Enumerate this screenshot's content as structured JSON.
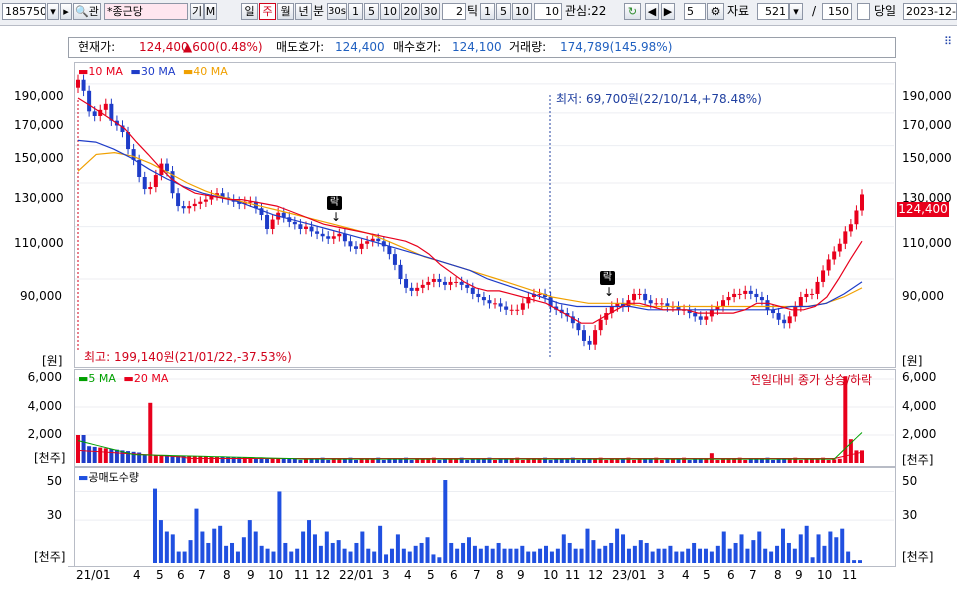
{
  "toolbar": {
    "code": "185750",
    "gwan": "관",
    "name": "*종근당",
    "gi": "기",
    "m": "M",
    "periods": [
      "일",
      "주",
      "월",
      "년"
    ],
    "selected_period": "주",
    "bun": "분",
    "s30": "30s",
    "n1": "1",
    "n5": "5",
    "n10": "10",
    "n20": "20",
    "n30": "30",
    "tick_value": "2",
    "tick": "틱",
    "t1": "1",
    "t5": "5",
    "t10": "10",
    "t10b": "10",
    "gwansim": "관심:22",
    "step_value": "5",
    "jaryo": "자료",
    "count_value": "521",
    "slash": "/",
    "total_value": "150",
    "dangil": "당일",
    "date_value": "2023-12-0"
  },
  "info": {
    "cur_label": "현재가:",
    "cur_value": "124,400",
    "change": "▲600(0.48%)",
    "ask_label": "매도호가:",
    "ask_value": "124,400",
    "bid_label": "매수호가:",
    "bid_value": "124,100",
    "vol_label": "거래량:",
    "vol_value": "174,789(145.98%)"
  },
  "price_panel": {
    "legend": [
      {
        "label": "10 MA",
        "color": "#e8001c"
      },
      {
        "label": "30 MA",
        "color": "#1e3cc8"
      },
      {
        "label": "40 MA",
        "color": "#f0a000"
      }
    ],
    "y_ticks": [
      "190,000",
      "170,000",
      "150,000",
      "130,000",
      "110,000",
      "90,000"
    ],
    "unit": "[원]",
    "low_note": "최저: 69,700원(22/10/14,+78.48%)",
    "high_note": "최고: 199,140원(21/01/22,-37.53%)",
    "current_price": "124,400",
    "arrow_label": "락"
  },
  "volume_panel": {
    "legend": [
      {
        "label": "5 MA",
        "color": "#00a000"
      },
      {
        "label": "20 MA",
        "color": "#e8001c"
      }
    ],
    "note": "전일대비 종가 상승/하락",
    "y_ticks": [
      "6,000",
      "4,000",
      "2,000"
    ],
    "unit": "[천주]"
  },
  "short_panel": {
    "legend": "공매도수량",
    "legend_color": "#2050e0",
    "y_ticks": [
      "50",
      "30"
    ],
    "unit": "[천주]"
  },
  "x_labels": [
    "21/01",
    "4",
    "5",
    "6",
    "7",
    "8",
    "9",
    "10",
    "11",
    "12",
    "22/01",
    "3",
    "4",
    "5",
    "6",
    "7",
    "8",
    "9",
    "10",
    "11",
    "12",
    "23/01",
    "3",
    "4",
    "5",
    "6",
    "7",
    "8",
    "9",
    "10",
    "11"
  ],
  "chart_data": {
    "type": "candlestick",
    "x_unit": "week",
    "ylim_price": [
      65000,
      205000
    ],
    "price_series_note": "weekly close (approx.)",
    "close": [
      193000,
      185000,
      171000,
      168000,
      172000,
      176000,
      165000,
      162000,
      158000,
      148000,
      142000,
      133000,
      127000,
      128000,
      134000,
      140000,
      136000,
      125000,
      119000,
      118000,
      119000,
      120000,
      121000,
      122000,
      124000,
      125000,
      123000,
      122000,
      121000,
      120000,
      121000,
      121000,
      118000,
      115000,
      109000,
      113000,
      116000,
      114000,
      112000,
      111000,
      109000,
      110000,
      108000,
      107000,
      106000,
      105000,
      106000,
      107000,
      104000,
      102000,
      101000,
      103000,
      104000,
      105000,
      104000,
      102000,
      99000,
      95000,
      90000,
      87000,
      86000,
      87000,
      88000,
      89000,
      90000,
      89000,
      88000,
      89000,
      89000,
      88000,
      87000,
      85000,
      84000,
      83000,
      82000,
      82000,
      81000,
      80000,
      80000,
      80000,
      82000,
      84000,
      85000,
      85000,
      84000,
      81000,
      80000,
      79000,
      78000,
      76000,
      74000,
      71000,
      70000,
      74000,
      77000,
      79000,
      81000,
      82000,
      81000,
      83000,
      85000,
      85000,
      83000,
      82000,
      82000,
      82000,
      81000,
      81000,
      80000,
      80000,
      79000,
      78000,
      77000,
      78000,
      80000,
      81000,
      83000,
      84000,
      85000,
      85000,
      86000,
      85000,
      84000,
      83000,
      80000,
      79000,
      77000,
      76000,
      78000,
      81000,
      84000,
      85000,
      85000,
      89000,
      93000,
      97000,
      100000,
      103000,
      108000,
      111000,
      117000,
      124400
    ],
    "ma_10": [
      180000,
      175000,
      170000,
      165000,
      160000,
      152000,
      145000,
      138000,
      132000,
      128000,
      125000,
      124000,
      123000,
      122000,
      122000,
      121000,
      120000,
      119000,
      117000,
      115000,
      113000,
      111000,
      110000,
      109000,
      108000,
      107000,
      106000,
      105000,
      104000,
      102000,
      99000,
      95000,
      92000,
      89000,
      87000,
      86000,
      86000,
      85000,
      84000,
      83000,
      82000,
      80000,
      78000,
      76000,
      76000,
      78000,
      80000,
      82000,
      82000,
      81000,
      80000,
      80000,
      80000,
      79000,
      79000,
      79000,
      79000,
      80000,
      82000,
      82000,
      81000,
      80000,
      80000,
      81000,
      84000,
      90000,
      97000,
      104000
    ],
    "ma_30": [
      153000,
      152000,
      148000,
      143000,
      137000,
      132000,
      128000,
      125000,
      123000,
      121000,
      118000,
      115000,
      113000,
      111000,
      109000,
      107000,
      105000,
      103000,
      101000,
      99000,
      97000,
      95000,
      93000,
      90000,
      88000,
      86000,
      84000,
      82000,
      81000,
      81000,
      81000,
      81000,
      80000,
      80000,
      80000,
      80000,
      80000,
      80000,
      80000,
      80000,
      81000,
      81000,
      82000,
      85000,
      89000
    ],
    "ma_40": [
      136000,
      145000,
      146000,
      144000,
      140000,
      135000,
      130000,
      126000,
      123000,
      121000,
      119000,
      117000,
      115000,
      113000,
      111000,
      109000,
      107000,
      104000,
      101000,
      98000,
      96000,
      94000,
      92000,
      90000,
      88000,
      86000,
      84000,
      83000,
      82000,
      82000,
      82000,
      81000,
      81000,
      81000,
      81000,
      81000,
      81000,
      81000,
      81000,
      81000,
      81000,
      82000,
      84000,
      87000
    ],
    "volume_ylim": [
      0,
      6500
    ],
    "short_ylim": [
      0,
      65
    ]
  }
}
